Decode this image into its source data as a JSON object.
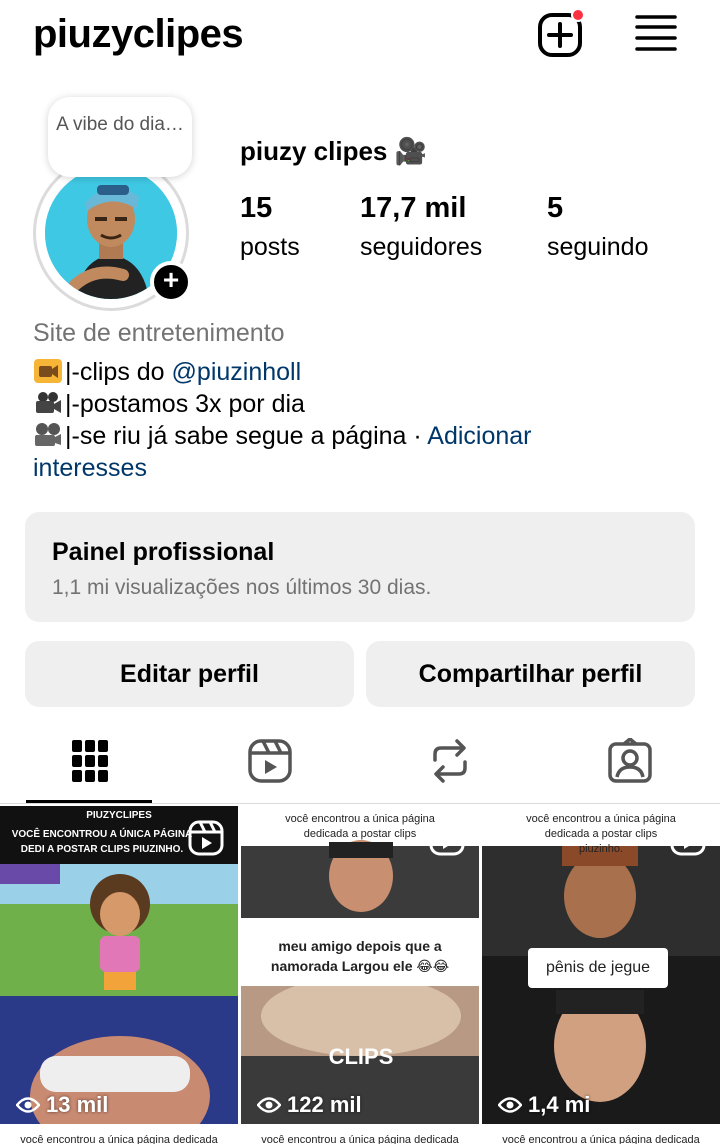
{
  "header": {
    "username": "piuzyclipes",
    "new_post_icon": "plus-square-icon",
    "menu_icon": "hamburger-menu-icon",
    "notification_color": "#ff3040"
  },
  "profile": {
    "note": "A vibe do dia…",
    "display_name": "piuzy clipes",
    "display_name_emoji": "🎥",
    "stats": {
      "posts_count": "15",
      "posts_label": "posts",
      "followers_count": "17,7 mil",
      "followers_label": "seguidores",
      "following_count": "5",
      "following_label": "seguindo"
    },
    "category": "Site de entretenimento",
    "bio": {
      "line1_text": "|-clips do ",
      "line1_mention": "@piuzinholl",
      "line2_text": "|-postamos 3x por dia",
      "line3_text": "|-se riu já sabe segue a página · ",
      "add_interests": "Adicionar",
      "add_interests_2": "interesses"
    }
  },
  "dashboard": {
    "title": "Painel profissional",
    "subtitle": "1,1 mi visualizações nos últimos 30 dias."
  },
  "actions": {
    "edit_profile": "Editar perfil",
    "share_profile": "Compartilhar perfil"
  },
  "tabs": {
    "icons": [
      "grid-icon",
      "reels-icon",
      "reposts-icon",
      "tagged-icon"
    ]
  },
  "grid": {
    "posts": [
      {
        "views": "13 mil",
        "caption_brand": "PIUZYCLIPES",
        "caption": "VOCÊ ENCONTROU A ÚNICA PÁGINA DEDI A POSTAR CLIPS PIUZINHO."
      },
      {
        "views": "122 mil",
        "caption": "você encontrou a única página dedicada a postar clips piuzinho.",
        "mid_caption": "meu amigo depois que a namorada Largou ele 😂😂"
      },
      {
        "views": "1,4 mi",
        "caption": "você encontrou a única página dedicada a postar clips piuzinho.",
        "mid_caption": "pênis de jegue"
      }
    ],
    "next_row_caption": "você encontrou a única página dedicada"
  }
}
